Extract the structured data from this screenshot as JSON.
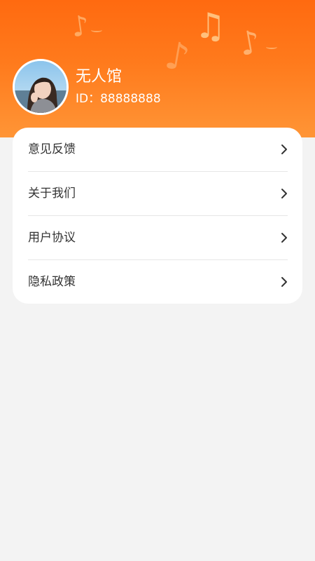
{
  "profile": {
    "name": "无人馆",
    "id_text": "ID：88888888"
  },
  "menu": {
    "items": [
      {
        "label": "意见反馈",
        "icon": "chevron-right-icon"
      },
      {
        "label": "关于我们",
        "icon": "chevron-right-icon"
      },
      {
        "label": "用户协议",
        "icon": "chevron-right-icon"
      },
      {
        "label": "隐私政策",
        "icon": "chevron-right-icon"
      }
    ]
  },
  "colors": {
    "header_top": "#ff6a10",
    "header_bottom": "#ff9536",
    "page_background": "#f3f3f3",
    "card_background": "#ffffff",
    "text_primary": "#333333"
  },
  "icons": {
    "decoration": "music-note-icon",
    "avatar": "avatar"
  }
}
